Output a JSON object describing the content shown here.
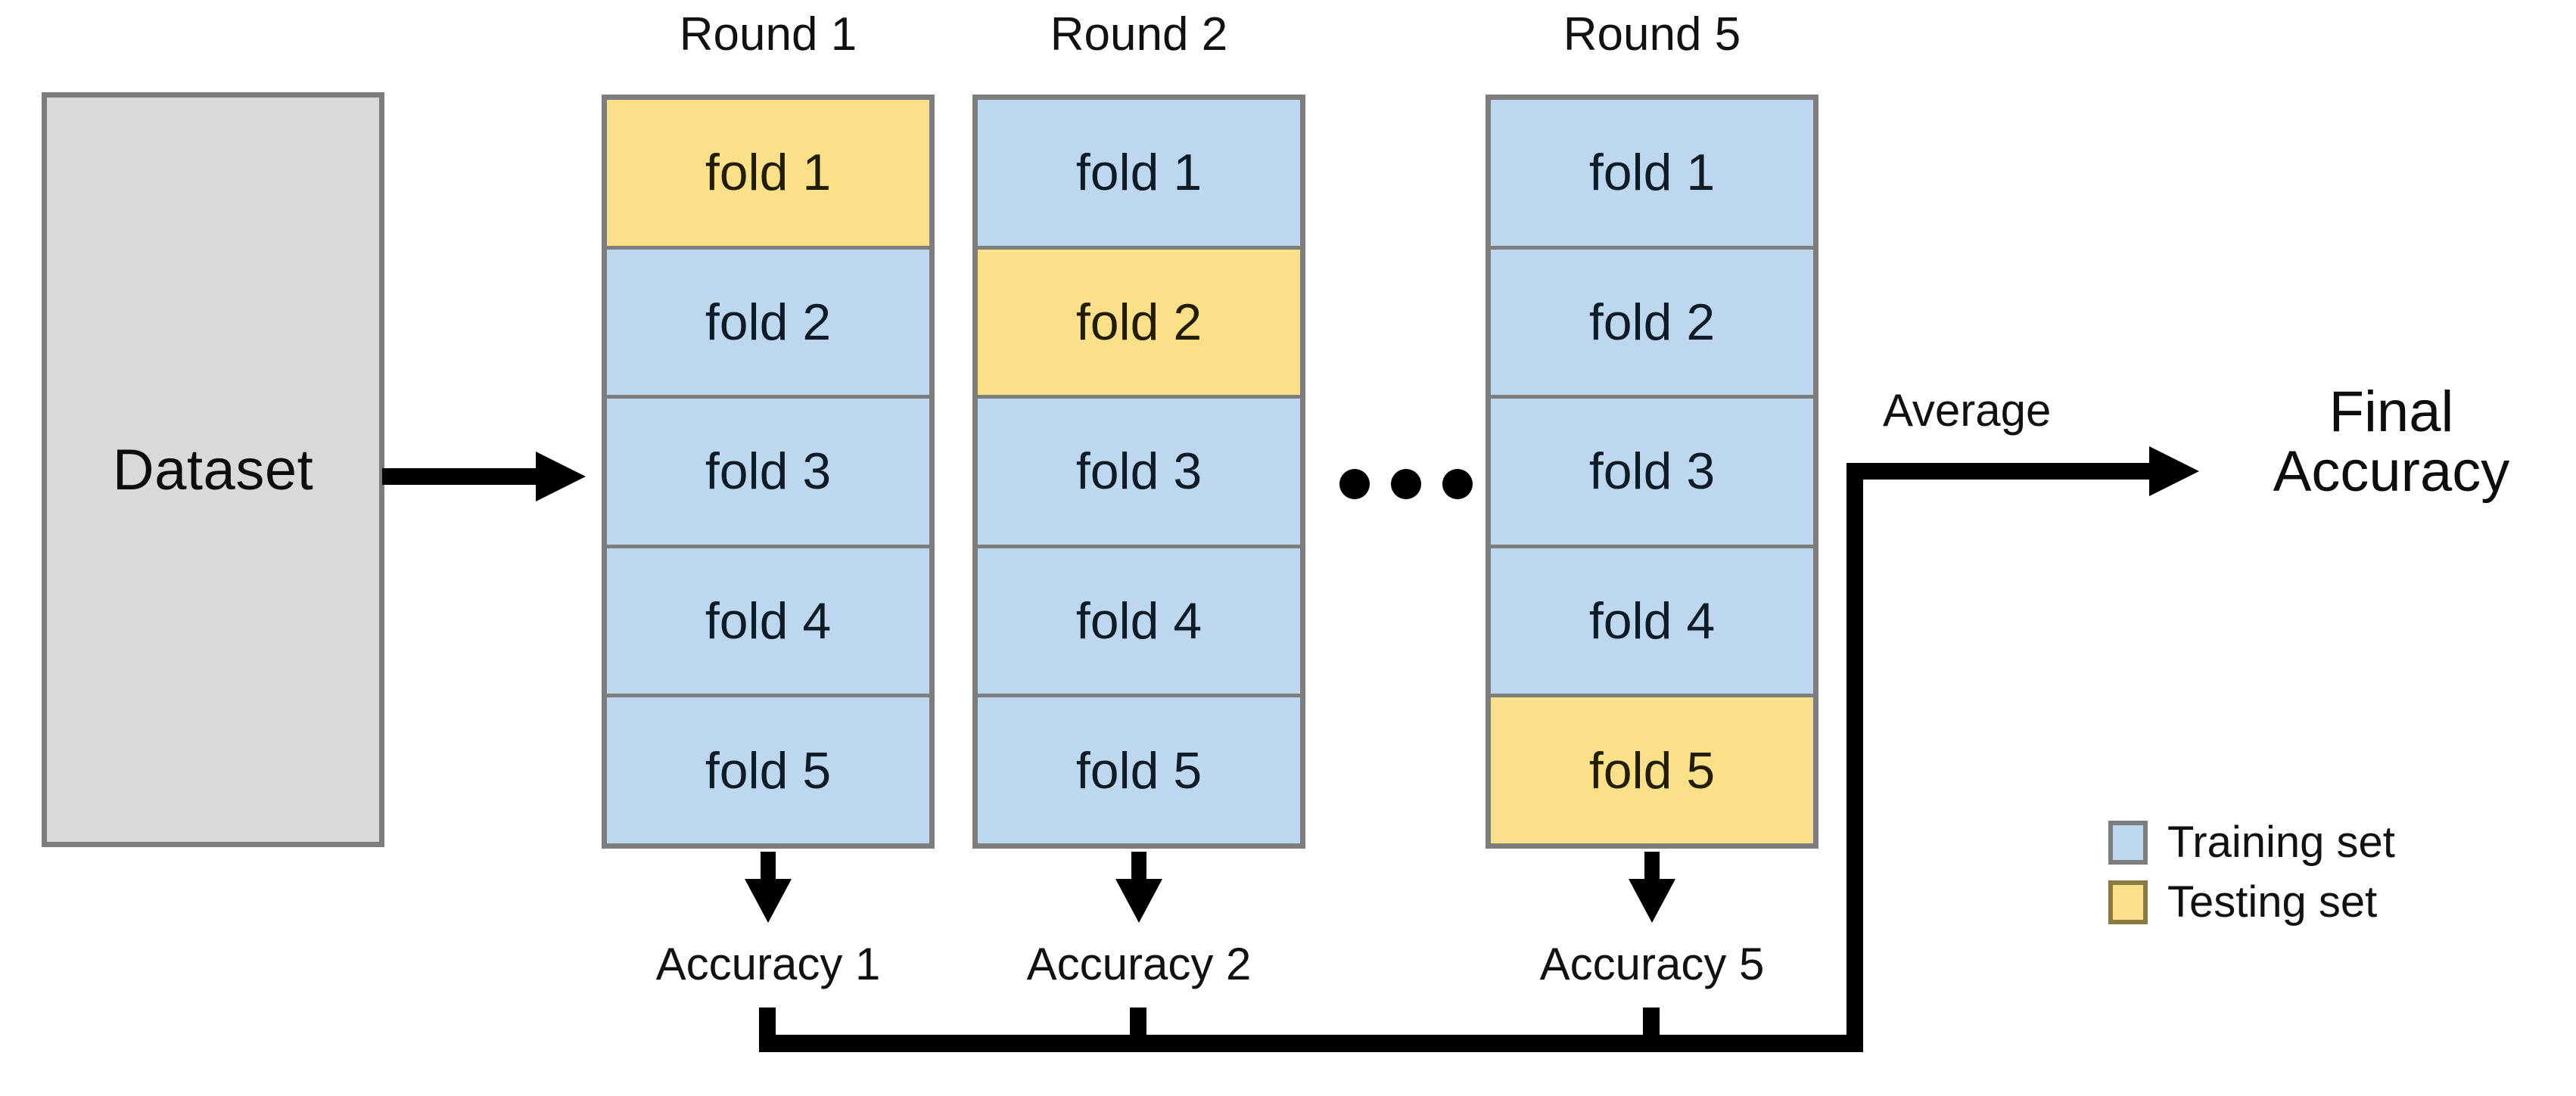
{
  "diagram": {
    "title_text": "",
    "source_block": {
      "label": "Dataset"
    },
    "flow_arrow_label": "",
    "rounds": [
      {
        "title": "Round 1",
        "folds": [
          {
            "label": "fold 1",
            "role": "test"
          },
          {
            "label": "fold 2",
            "role": "train"
          },
          {
            "label": "fold 3",
            "role": "train"
          },
          {
            "label": "fold 4",
            "role": "train"
          },
          {
            "label": "fold 5",
            "role": "train"
          }
        ],
        "accuracy_label": "Accuracy 1"
      },
      {
        "title": "Round 2",
        "folds": [
          {
            "label": "fold 1",
            "role": "train"
          },
          {
            "label": "fold 2",
            "role": "test"
          },
          {
            "label": "fold 3",
            "role": "train"
          },
          {
            "label": "fold 4",
            "role": "train"
          },
          {
            "label": "fold 5",
            "role": "train"
          }
        ],
        "accuracy_label": "Accuracy 2"
      },
      {
        "title": "Round 5",
        "folds": [
          {
            "label": "fold 1",
            "role": "train"
          },
          {
            "label": "fold 2",
            "role": "train"
          },
          {
            "label": "fold 3",
            "role": "train"
          },
          {
            "label": "fold 4",
            "role": "train"
          },
          {
            "label": "fold 5",
            "role": "test"
          }
        ],
        "accuracy_label": "Accuracy 5"
      }
    ],
    "ellipsis": "• • •",
    "aggregate": {
      "operation_label": "Average",
      "result_label_line1": "Final",
      "result_label_line2": "Accuracy"
    },
    "legend": {
      "items": [
        {
          "label": "Training set",
          "swatch": "train",
          "color": "#BDD7EE"
        },
        {
          "label": "Testing set",
          "swatch": "test",
          "color": "#FBE08A"
        }
      ]
    },
    "colors": {
      "training": "#BDD7EE",
      "testing": "#FBE08A",
      "dataset": "#D9D9D9",
      "border": "#7D7D7D",
      "connector": "#000000",
      "background": "#FFFFFF"
    }
  }
}
